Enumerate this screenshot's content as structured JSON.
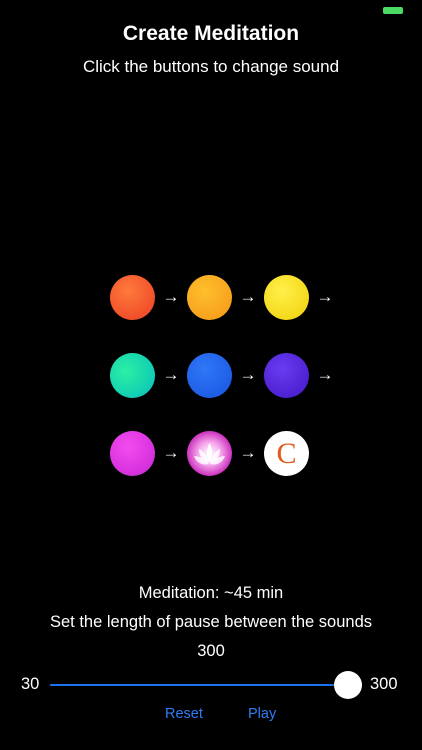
{
  "status_bar": {
    "battery_color": "#4cd964"
  },
  "header": {
    "title": "Create Meditation",
    "subtitle": "Click the buttons to change sound"
  },
  "arrow_glyph": "→",
  "sounds": {
    "rows": [
      {
        "orbs": [
          "orange-orb",
          "amber-orb",
          "yellow-orb"
        ]
      },
      {
        "orbs": [
          "teal-orb",
          "blue-orb",
          "violet-orb"
        ]
      },
      {
        "orbs": [
          "magenta-orb",
          "lotus-orb",
          "c-logo-orb"
        ]
      }
    ],
    "logo_letter": "C"
  },
  "meditation": {
    "duration_label": "Meditation: ~45 min"
  },
  "pause": {
    "label": "Set the length of pause between the sounds",
    "value": "300",
    "min_label": "30",
    "max_label": "300",
    "min": 30,
    "max": 300,
    "current": 300
  },
  "controls": {
    "reset_label": "Reset",
    "play_label": "Play"
  },
  "colors": {
    "accent": "#2f7df6",
    "slider_fill": "#1a72f0"
  }
}
